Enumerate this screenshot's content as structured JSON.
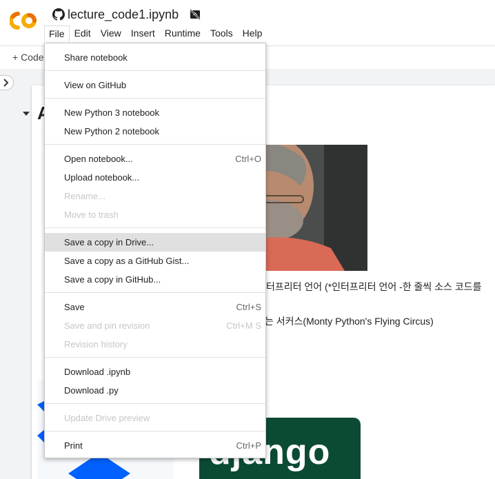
{
  "header": {
    "notebook_title": "lecture_code1.ipynb"
  },
  "menubar": {
    "items": [
      "File",
      "Edit",
      "View",
      "Insert",
      "Runtime",
      "Tools",
      "Help"
    ]
  },
  "toolbar": {
    "add_code_label": "+ Code"
  },
  "notebook": {
    "heading_fragment": "A",
    "line1": "터프리터 언어 (*인터프리터 언어 -한 줄씩 소스 코드를",
    "line2": "는 서커스(Monty Python's Flying Circus)",
    "django_logo_text": "django"
  },
  "file_menu": {
    "items": [
      {
        "label": "Share notebook",
        "shortcut": "",
        "disabled": false
      },
      {
        "label": "View on GitHub",
        "shortcut": "",
        "disabled": false
      },
      {
        "label": "New Python 3 notebook",
        "shortcut": "",
        "disabled": false
      },
      {
        "label": "New Python 2 notebook",
        "shortcut": "",
        "disabled": false
      },
      {
        "label": "Open notebook...",
        "shortcut": "Ctrl+O",
        "disabled": false
      },
      {
        "label": "Upload notebook...",
        "shortcut": "",
        "disabled": false
      },
      {
        "label": "Rename...",
        "shortcut": "",
        "disabled": true
      },
      {
        "label": "Move to trash",
        "shortcut": "",
        "disabled": true
      },
      {
        "label": "Save a copy in Drive...",
        "shortcut": "",
        "disabled": false,
        "highlighted": true
      },
      {
        "label": "Save a copy as a GitHub Gist...",
        "shortcut": "",
        "disabled": false
      },
      {
        "label": "Save a copy in GitHub...",
        "shortcut": "",
        "disabled": false
      },
      {
        "label": "Save",
        "shortcut": "Ctrl+S",
        "disabled": false
      },
      {
        "label": "Save and pin revision",
        "shortcut": "Ctrl+M S",
        "disabled": true
      },
      {
        "label": "Revision history",
        "shortcut": "",
        "disabled": true
      },
      {
        "label": "Download .ipynb",
        "shortcut": "",
        "disabled": false
      },
      {
        "label": "Download .py",
        "shortcut": "",
        "disabled": false
      },
      {
        "label": "Update Drive preview",
        "shortcut": "",
        "disabled": true
      },
      {
        "label": "Print",
        "shortcut": "Ctrl+P",
        "disabled": false
      }
    ]
  },
  "colors": {
    "colab_orange": "#f9ab00",
    "colab_yellow": "#e8710a",
    "django_green": "#0c4b33",
    "dropbox_blue": "#0061fe",
    "menu_highlight": "#e0e0e0"
  }
}
